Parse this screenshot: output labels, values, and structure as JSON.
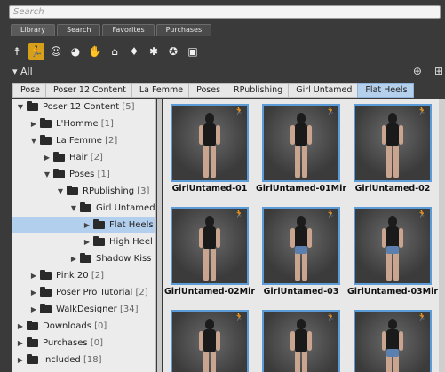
{
  "search": {
    "placeholder": "Search"
  },
  "tabs": [
    {
      "label": "Library",
      "active": true
    },
    {
      "label": "Search",
      "active": false
    },
    {
      "label": "Favorites",
      "active": false
    },
    {
      "label": "Purchases",
      "active": false
    }
  ],
  "category_icons": [
    "figure-icon",
    "pose-icon",
    "face-icon",
    "hair-icon",
    "hand-icon",
    "props-icon",
    "light-icon",
    "camera-icon",
    "scene-icon",
    "render-icon"
  ],
  "all_label": "All",
  "breadcrumb": [
    "Pose",
    "Poser 12 Content",
    "La Femme",
    "Poses",
    "RPublishing",
    "Girl Untamed",
    "Flat Heels"
  ],
  "tree": [
    {
      "label": "Poser 12 Content",
      "count": "[5]",
      "level": 0,
      "open": true
    },
    {
      "label": "L'Homme",
      "count": "[1]",
      "level": 1,
      "open": false
    },
    {
      "label": "La Femme",
      "count": "[2]",
      "level": 1,
      "open": true
    },
    {
      "label": "Hair",
      "count": "[2]",
      "level": 2,
      "open": false
    },
    {
      "label": "Poses",
      "count": "[1]",
      "level": 2,
      "open": true
    },
    {
      "label": "RPublishing",
      "count": "[3]",
      "level": 3,
      "open": true
    },
    {
      "label": "Girl Untamed",
      "count": "",
      "level": 4,
      "open": true
    },
    {
      "label": "Flat Heels",
      "count": "",
      "level": 5,
      "open": false,
      "selected": true
    },
    {
      "label": "High Heel",
      "count": "",
      "level": 5,
      "open": false
    },
    {
      "label": "Shadow Kiss",
      "count": "",
      "level": 4,
      "open": false
    },
    {
      "label": "Pink 20",
      "count": "[2]",
      "level": 1,
      "open": false
    },
    {
      "label": "Poser Pro Tutorial",
      "count": "[2]",
      "level": 1,
      "open": false
    },
    {
      "label": "WalkDesigner",
      "count": "[34]",
      "level": 1,
      "open": false
    },
    {
      "label": "Downloads",
      "count": "[0]",
      "level": 0,
      "open": false
    },
    {
      "label": "Purchases",
      "count": "[0]",
      "level": 0,
      "open": false
    },
    {
      "label": "Included",
      "count": "[18]",
      "level": 0,
      "open": false
    }
  ],
  "thumbnails": [
    {
      "caption": "GirlUntamed-01",
      "outfit": "dark"
    },
    {
      "caption": "GirlUntamed-01Mir",
      "outfit": "dark"
    },
    {
      "caption": "GirlUntamed-02",
      "outfit": "dark"
    },
    {
      "caption": "GirlUntamed-02Mir",
      "outfit": "dark"
    },
    {
      "caption": "GirlUntamed-03",
      "outfit": "jeans"
    },
    {
      "caption": "GirlUntamed-03Mir",
      "outfit": "jeans"
    },
    {
      "caption": "",
      "outfit": "dark"
    },
    {
      "caption": "",
      "outfit": "dark"
    },
    {
      "caption": "",
      "outfit": "jeans"
    }
  ]
}
